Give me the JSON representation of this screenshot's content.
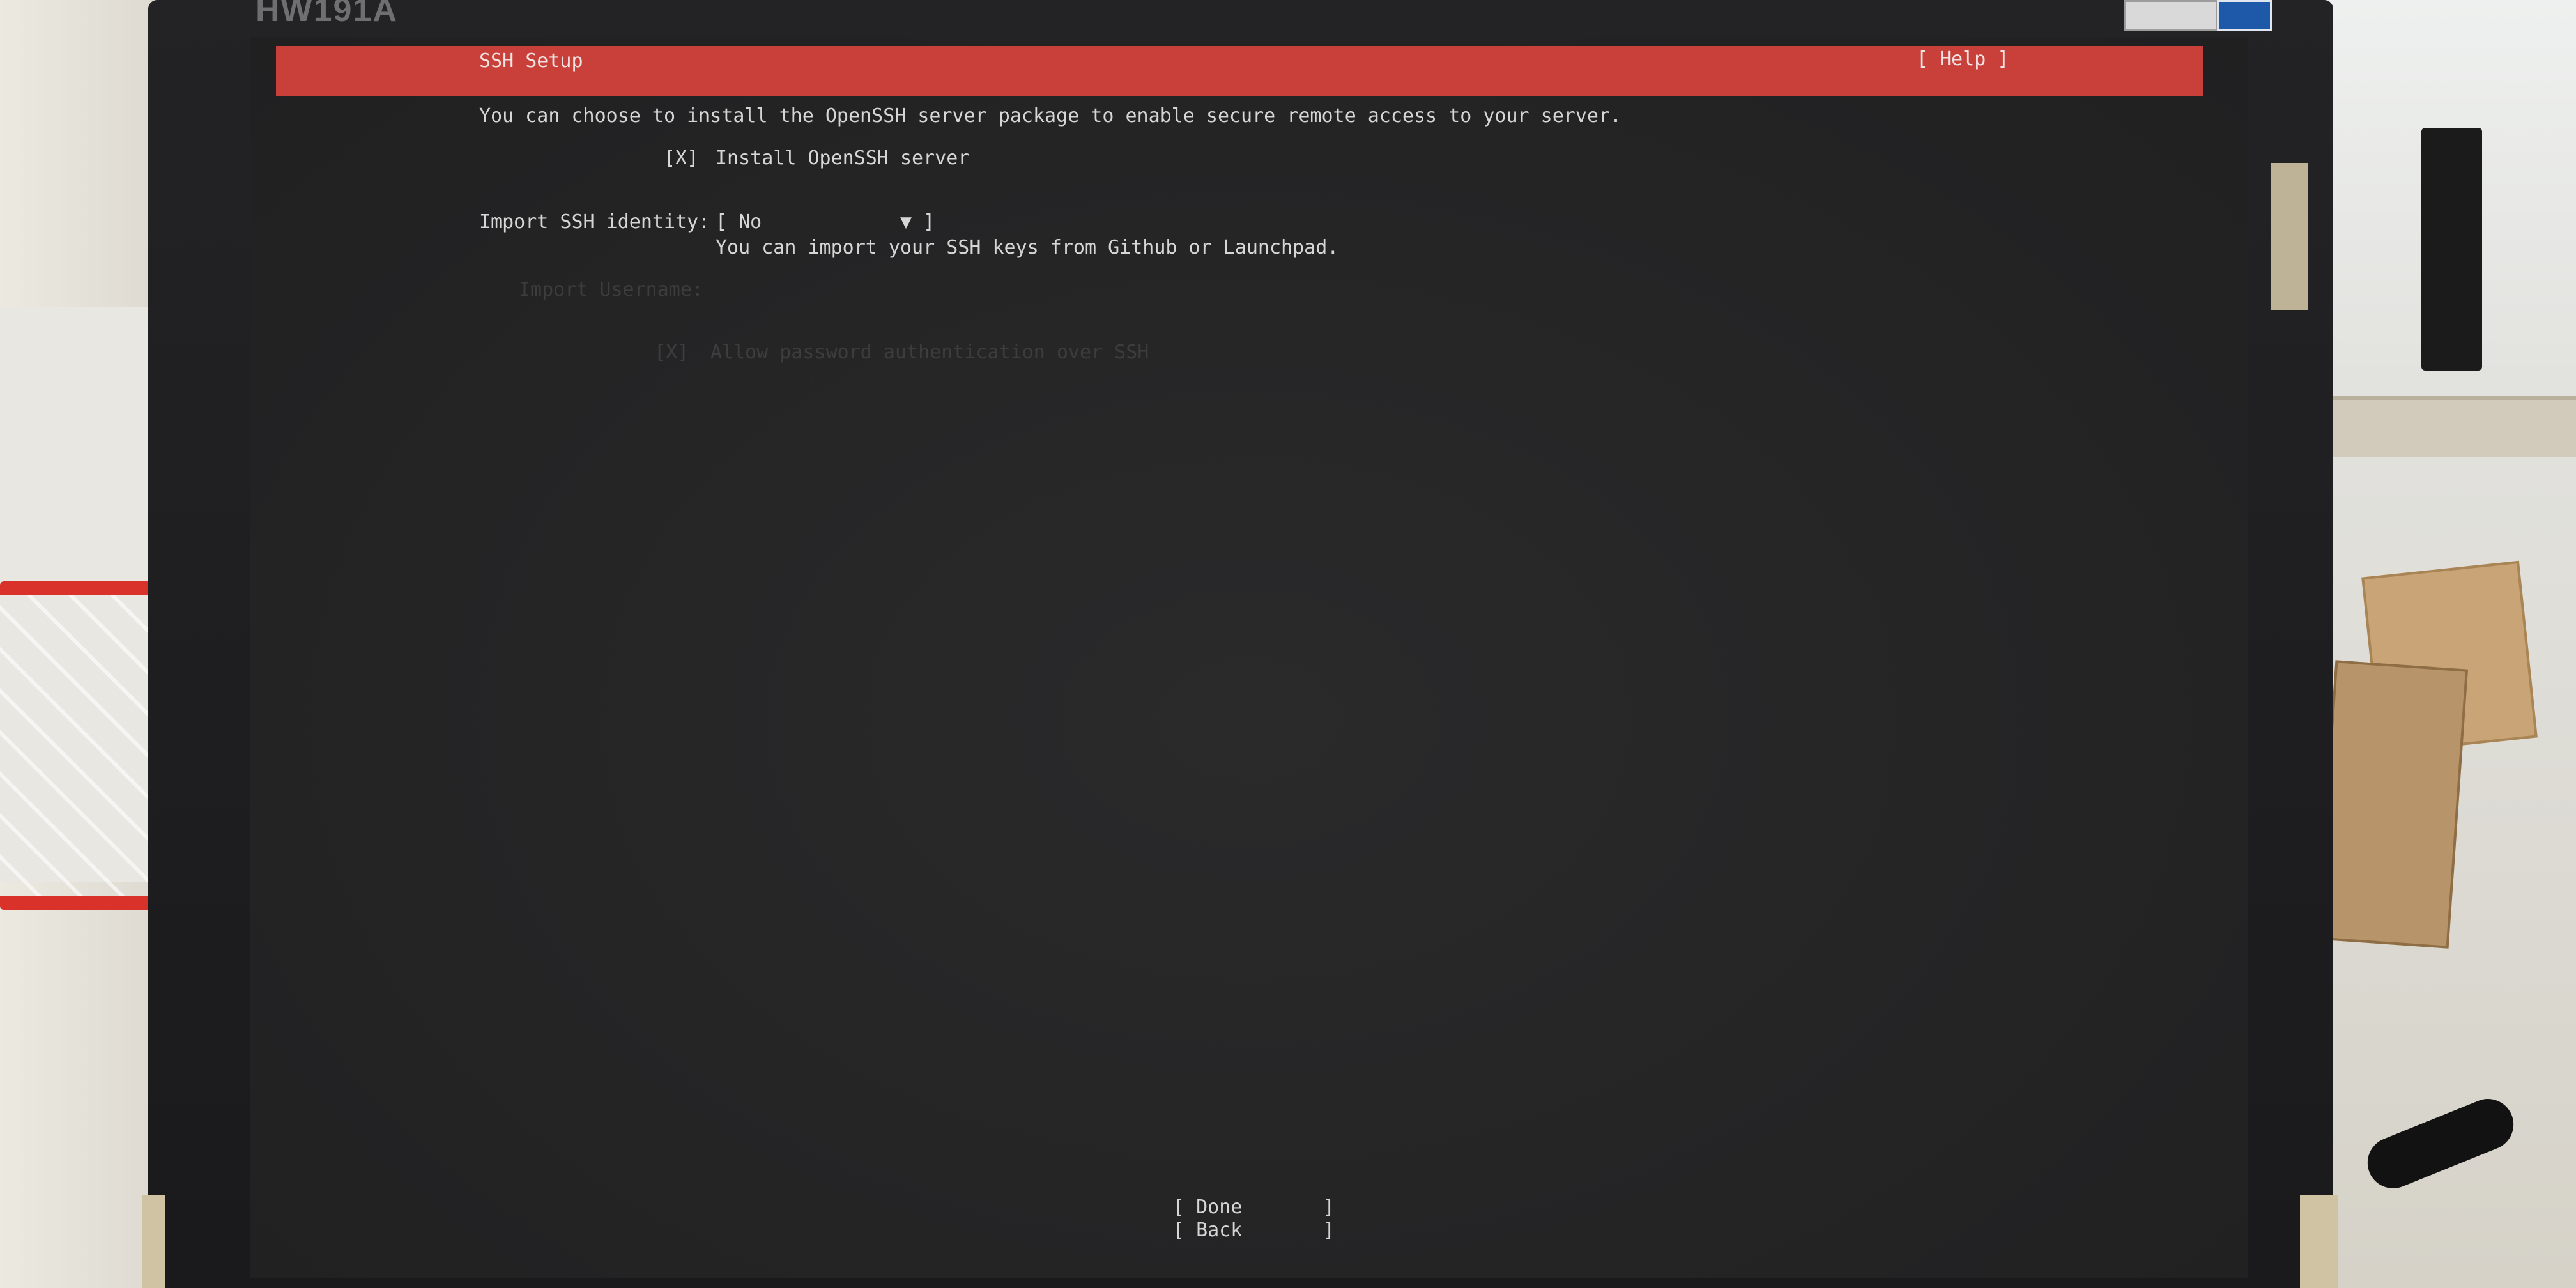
{
  "monitor": {
    "brand": "HW191A"
  },
  "header": {
    "title": "SSH Setup",
    "help_label": "[ Help ]"
  },
  "intro_text": "You can choose to install the OpenSSH server package to enable secure remote access to your server.",
  "install_openssh": {
    "checkbox": "[X]",
    "label": "Install OpenSSH server"
  },
  "import_identity": {
    "label": "Import SSH identity:",
    "selected_value": "[ No            ▼ ]",
    "help": "You can import your SSH keys from Github or Launchpad."
  },
  "import_username": {
    "label": "Import Username:"
  },
  "allow_password": {
    "checkbox": "[X]",
    "label": "Allow password authentication over SSH"
  },
  "actions": {
    "done_label": "[ Done       ]",
    "back_label": "[ Back       ]"
  },
  "colors": {
    "title_bar": "#c9403a",
    "screen_background": "#262627",
    "text": "#d6d6d6",
    "disabled_text": "#3d3d3e"
  }
}
